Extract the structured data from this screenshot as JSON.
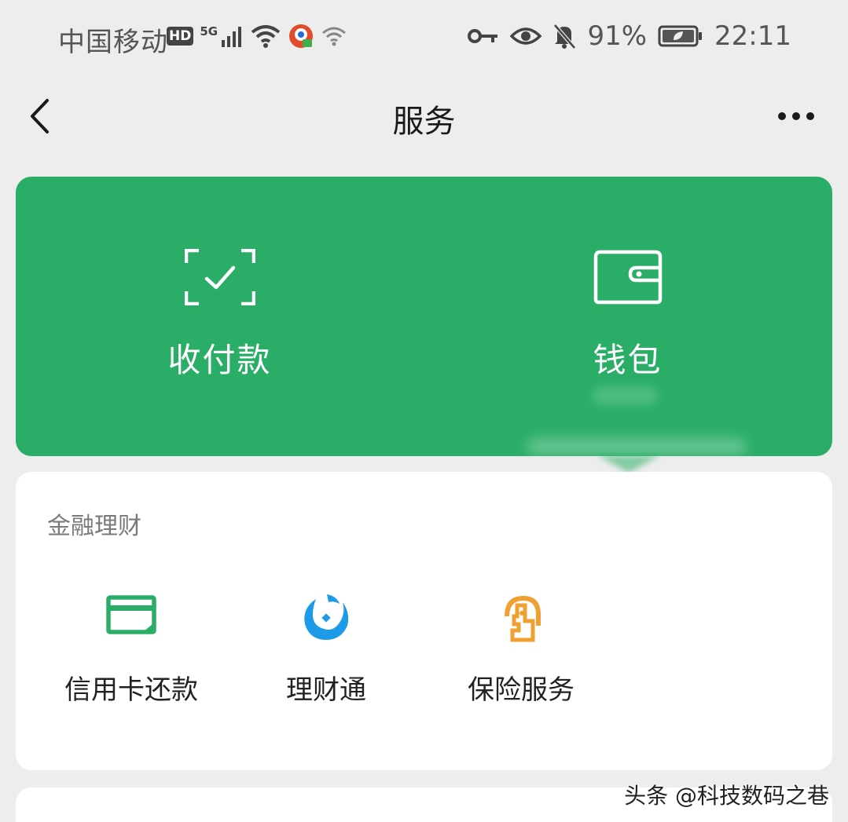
{
  "status_bar": {
    "carrier": "中国移动",
    "hd": "HD",
    "network": "5G",
    "battery_percent": "91%",
    "time": "22:11"
  },
  "nav": {
    "title": "服务"
  },
  "pay_card": {
    "collect_label": "收付款",
    "wallet_label": "钱包",
    "accent_color": "#2aae67"
  },
  "finance": {
    "section_title": "金融理财",
    "services": [
      {
        "label": "信用卡还款",
        "icon": "credit-card-icon",
        "color": "#2aae67"
      },
      {
        "label": "理财通",
        "icon": "wealth-icon",
        "color": "#1e9be8"
      },
      {
        "label": "保险服务",
        "icon": "insurance-icon",
        "color": "#f0a030"
      }
    ]
  },
  "watermark": "头条 @科技数码之巷"
}
